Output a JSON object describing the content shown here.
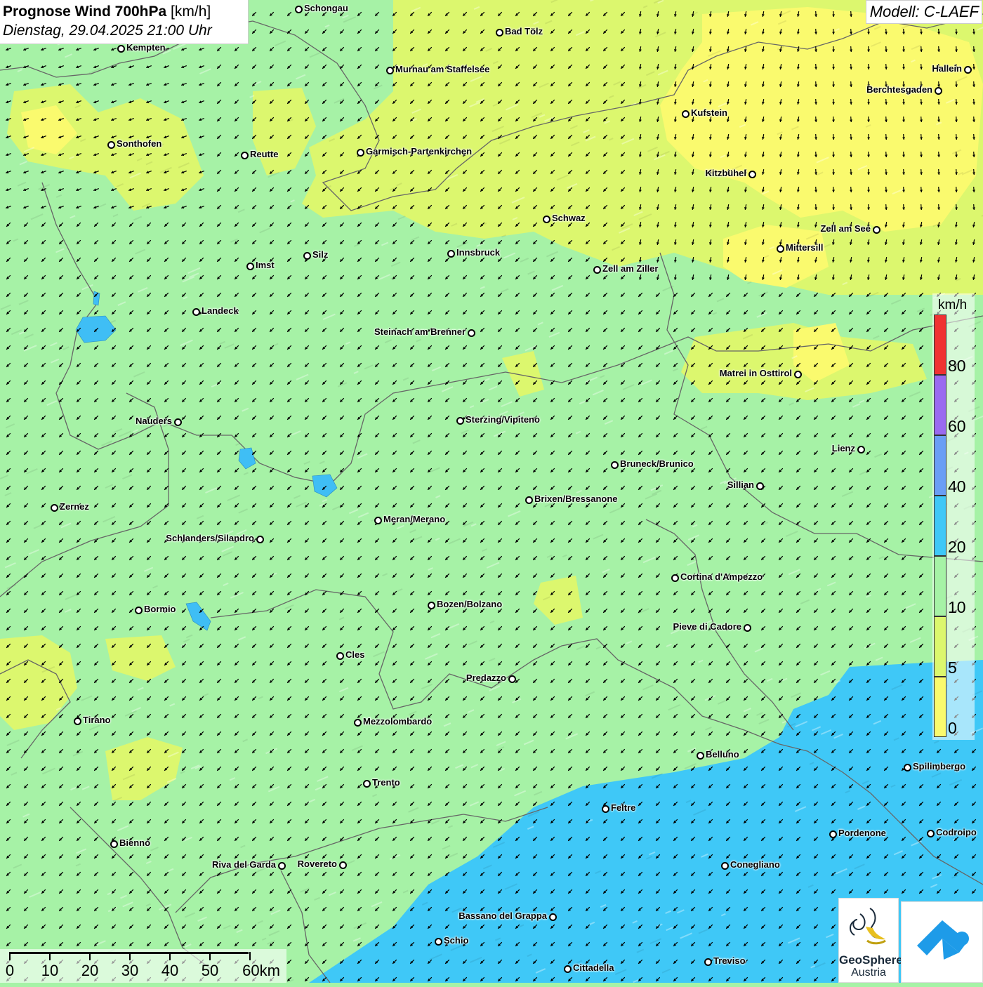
{
  "header": {
    "title_bold": "Prognose Wind 700hPa",
    "title_unit": "[km/h]",
    "datetime": "Dienstag, 29.04.2025 21:00 Uhr",
    "model": "Modell: C-LAEF"
  },
  "legend": {
    "unit": "km/h",
    "bands": [
      {
        "label": "0",
        "color": "#fafa6e"
      },
      {
        "label": "5",
        "color": "#dcf76e"
      },
      {
        "label": "10",
        "color": "#a6f2a6"
      },
      {
        "label": "20",
        "color": "#3fc8f7"
      },
      {
        "label": "40",
        "color": "#6a9ef5"
      },
      {
        "label": "60",
        "color": "#9a6af0"
      },
      {
        "label": "80",
        "color": "#f03232"
      }
    ]
  },
  "scale_bar": {
    "labels": [
      "0",
      "10",
      "20",
      "30",
      "40",
      "50",
      "60km"
    ]
  },
  "logos": {
    "geosphere_line1": "GeoSphere",
    "geosphere_line2": "Austria"
  },
  "field": {
    "dominant_wind_direction": "from north-east",
    "colors": {
      "calm": "#fafa6e",
      "light": "#dcf76e",
      "moderate": "#a6f2a6",
      "fresh": "#3fc8f7"
    }
  },
  "cities": [
    {
      "name": "Schongau"
    },
    {
      "name": "Bad Tölz"
    },
    {
      "name": "Kempten"
    },
    {
      "name": "Murnau am Staffelsee"
    },
    {
      "name": "Hallein"
    },
    {
      "name": "Berchtesgaden"
    },
    {
      "name": "Kufstein"
    },
    {
      "name": "Sonthofen"
    },
    {
      "name": "Reutte"
    },
    {
      "name": "Garmisch-Partenkirchen"
    },
    {
      "name": "Kitzbühel"
    },
    {
      "name": "Schwaz"
    },
    {
      "name": "Zell am See"
    },
    {
      "name": "Mittersill"
    },
    {
      "name": "Silz"
    },
    {
      "name": "Innsbruck"
    },
    {
      "name": "Imst"
    },
    {
      "name": "Zell am Ziller"
    },
    {
      "name": "Landeck"
    },
    {
      "name": "Steinach am Brenner"
    },
    {
      "name": "Matrei in Osttirol"
    },
    {
      "name": "Nauders"
    },
    {
      "name": "Sterzing/Vipiteno"
    },
    {
      "name": "Lienz"
    },
    {
      "name": "Bruneck/Brunico"
    },
    {
      "name": "Sillian"
    },
    {
      "name": "Brixen/Bressanone"
    },
    {
      "name": "Zernez"
    },
    {
      "name": "Meran/Merano"
    },
    {
      "name": "Schlanders/Silandro"
    },
    {
      "name": "Cortina d'Ampezzo"
    },
    {
      "name": "Bozen/Bolzano"
    },
    {
      "name": "Bormio"
    },
    {
      "name": "Pieve di Cadore"
    },
    {
      "name": "Cles"
    },
    {
      "name": "Predazzo"
    },
    {
      "name": "Tirano"
    },
    {
      "name": "Mezzolombardo"
    },
    {
      "name": "Belluno"
    },
    {
      "name": "Spilimbergo"
    },
    {
      "name": "Trento"
    },
    {
      "name": "Feltre"
    },
    {
      "name": "Pordenone"
    },
    {
      "name": "Codroipo"
    },
    {
      "name": "Bienno"
    },
    {
      "name": "Riva del Garda"
    },
    {
      "name": "Rovereto"
    },
    {
      "name": "Conegliano"
    },
    {
      "name": "Bassano del Grappa"
    },
    {
      "name": "Schio"
    },
    {
      "name": "Treviso"
    },
    {
      "name": "Cittadella"
    }
  ]
}
